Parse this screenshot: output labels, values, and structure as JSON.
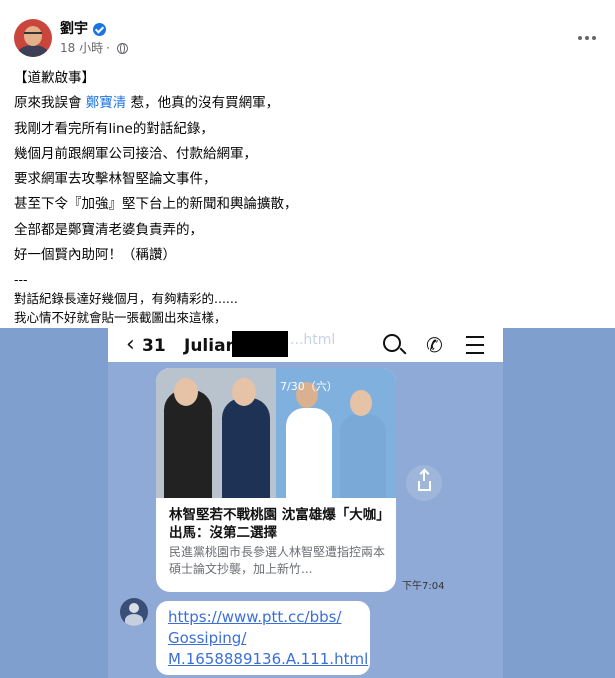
{
  "post": {
    "author": "劉宇",
    "time": "18 小時",
    "separator": "·",
    "lines": [
      {
        "text": "【道歉啟事】"
      },
      {
        "before": "原來我誤會 ",
        "mention": "鄭寶清",
        "after": " 惹，他真的沒有買網軍，"
      },
      {
        "text": "我剛才看完所有line的對話紀錄，"
      },
      {
        "text": "幾個月前跟網軍公司接洽、付款給網軍，"
      },
      {
        "text": "要求網軍去攻擊林智堅論文事件，"
      },
      {
        "text": "甚至下令『加強』堅下台上的新聞和輿論擴散，"
      },
      {
        "text": "全部都是鄭寶清老婆負責弄的，"
      },
      {
        "text": "好一個賢內助阿！（稱讚）"
      }
    ],
    "divider": "---",
    "footer_lines": [
      "對話紀錄長達好幾個月，有夠精彩的......",
      "我心情不好就會貼一張截圖出來這樣，"
    ]
  },
  "chat": {
    "back_count": "31",
    "contact_name": "Julian",
    "faded_text": "...html",
    "news_card": {
      "image_date": "7/30（六）",
      "title": "林智堅若不戰桃園 沈富雄爆「大咖」出馬：沒第二選擇",
      "description": "民進黨桃園市長參選人林智堅遭指控兩本碩士論文抄襲，加上新竹..."
    },
    "message_time": "下午7:04",
    "link_lines": [
      "https://www.ptt.cc/bbs/",
      "Gossiping/",
      "M.1658889136.A.111.html"
    ]
  },
  "colors": {
    "accent": "#1b74e4",
    "chat_background": "#8faad6",
    "link": "#3a6fd8"
  }
}
